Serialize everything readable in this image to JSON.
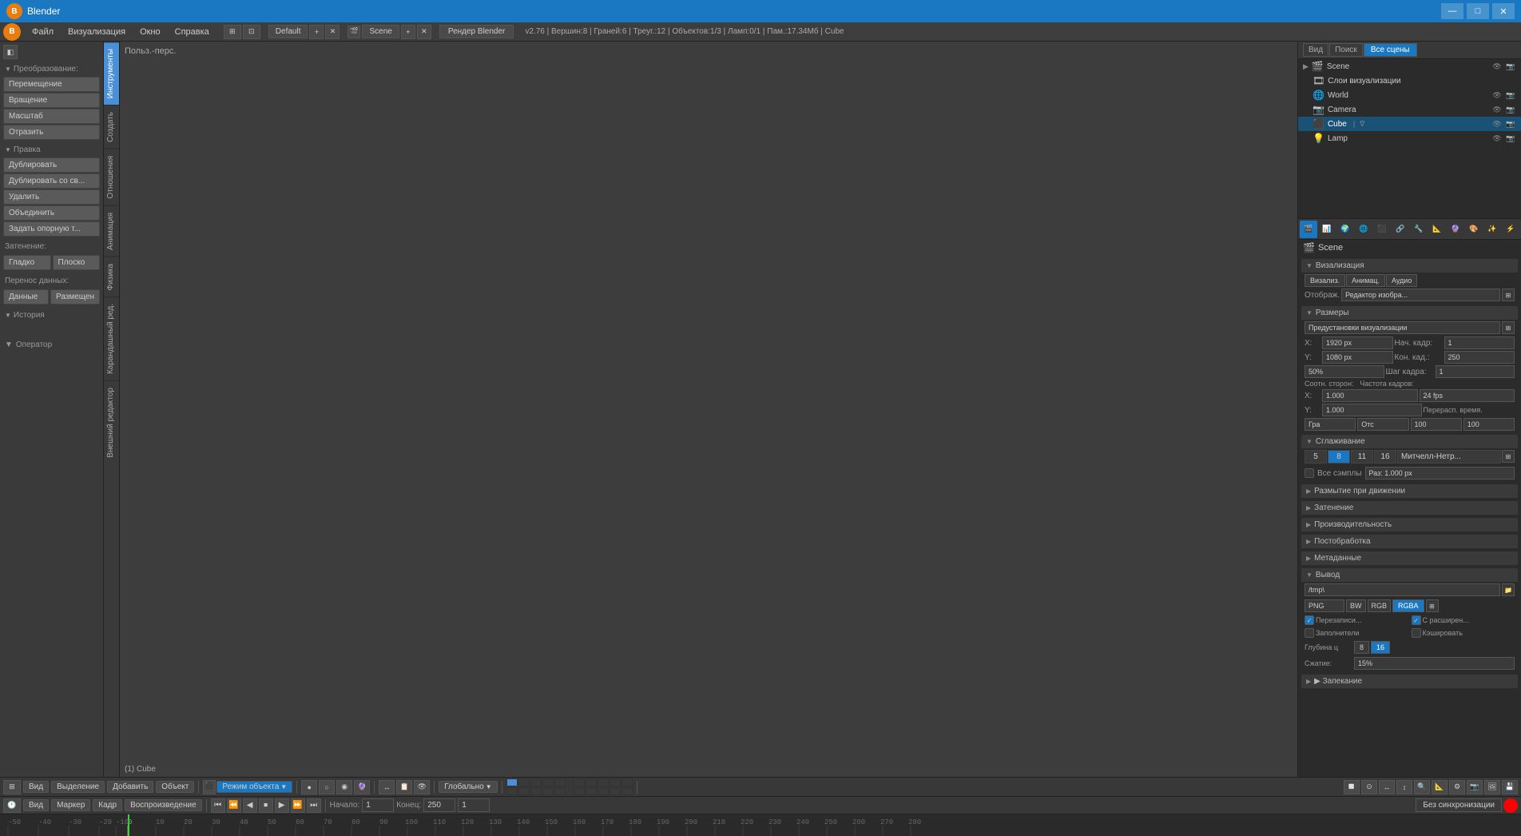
{
  "titlebar": {
    "logo": "B",
    "title": "Blender",
    "minimize": "—",
    "maximize": "□",
    "close": "✕"
  },
  "menubar": {
    "items": [
      "Файл",
      "Визуализация",
      "Окно",
      "Справка"
    ]
  },
  "header": {
    "engine": "Рендер Blender",
    "scene": "Scene",
    "workspace": "Default",
    "info": "v2.76 | Вершин:8 | Граней:6 | Треуг.:12 | Объектов:1/3 | Ламп:0/1 | Пам.:17.34Мб | Cube"
  },
  "viewport": {
    "mode_label": "Польз.-перс.",
    "object_label": "(1) Cube"
  },
  "left_panel": {
    "transform_title": "Преобразование:",
    "buttons": {
      "move": "Перемещение",
      "rotate": "Вращение",
      "scale": "Масштаб",
      "mirror": "Отразить",
      "edit_title": "Правка",
      "duplicate": "Дублировать",
      "dup_linked": "Дублировать со св...",
      "delete": "Удалить",
      "join": "Объединить",
      "set_origin": "Задать опорную т...",
      "shading_title": "Затенение:",
      "smooth": "Гладко",
      "flat": "Плоско",
      "data_title": "Перенос данных:",
      "data": "Данные",
      "layout": "Размещен",
      "history_title": "История"
    }
  },
  "outliner": {
    "tabs": [
      "Вид",
      "Поиск",
      "Все сцены"
    ],
    "items": [
      {
        "name": "Scene",
        "type": "scene",
        "indent": 0
      },
      {
        "name": "Слои визуализации",
        "type": "layer",
        "indent": 1
      },
      {
        "name": "World",
        "type": "world",
        "indent": 1
      },
      {
        "name": "Camera",
        "type": "camera",
        "indent": 1
      },
      {
        "name": "Cube",
        "type": "mesh",
        "indent": 1,
        "selected": true
      },
      {
        "name": "Lamp",
        "type": "lamp",
        "indent": 1
      }
    ]
  },
  "properties": {
    "scene_name": "Scene",
    "tabs": [
      "render",
      "render_layers",
      "scene",
      "world",
      "object",
      "constraints",
      "modifiers",
      "data",
      "material",
      "texture",
      "particles",
      "physics"
    ],
    "active_tab": "render",
    "visualize": {
      "title": "Визализация",
      "tabs": [
        "Визализ.",
        "Анимац.",
        "Аудио"
      ],
      "display_label": "Отображ.",
      "display_value": "Редактор изобра..."
    },
    "resolution": {
      "title": "Размеры",
      "preset_label": "Предустановки визуализации",
      "x_label": "X:",
      "x_value": "1920 px",
      "y_label": "Y:",
      "y_value": "1080 px",
      "percent": "50%",
      "start_frame_label": "Нач. кадр:",
      "start_frame": "1",
      "end_frame_label": "Кон. кад.:",
      "end_frame": "250",
      "frame_step_label": "Шаг кадра:",
      "frame_step": "1",
      "aspect_x_label": "X:",
      "aspect_x": "1.000",
      "aspect_y_label": "Y:",
      "aspect_y": "1.000",
      "frame_rate": "24 fps",
      "speed_label": "Перерасп. время.",
      "aspect_label": "Соотн. сторон:",
      "fps_label": "Частота кадров:",
      "fps_buttons": [
        "Гра",
        "Отс",
        "100",
        "100"
      ]
    },
    "antialiasing": {
      "title": "Сглаживание",
      "values": [
        "5",
        "8",
        "11",
        "16"
      ],
      "active": "8",
      "filter_label": "Митчелл-Нетр...",
      "all_samples": "Все сэмплы",
      "sample_size": "Раз: 1.000 px"
    },
    "motion_blur": {
      "title": "Размытие при движении"
    },
    "shading": {
      "title": "Затенение"
    },
    "performance": {
      "title": "Производительность"
    },
    "post_processing": {
      "title": "Постобработка"
    },
    "metadata": {
      "title": "Метаданные"
    },
    "output": {
      "title": "Вывод",
      "path": "/tmp\\",
      "format": "PNG",
      "bw_btn": "BW",
      "rgb_btn": "RGB",
      "rgba_btn": "RGBA",
      "overwrite_label": "Перезаписи...",
      "placeholders_label": "Заполнители",
      "cache_label": "Кэшировать",
      "with_ext_label": "С расширен...",
      "color_depth_label": "Глубина ц",
      "color_depth_values": [
        "8",
        "16"
      ],
      "compression_label": "Сжатие:",
      "compression_value": "15%"
    }
  },
  "bottom_bar": {
    "tabs_left": [
      "Вид",
      "Выделение",
      "Добавить",
      "Объект"
    ],
    "mode_btn": "Режим объекта",
    "pivot": "Глобально",
    "object_label": "(1) Cube"
  },
  "timeline": {
    "tabs_left": [
      "Вид",
      "Маркер",
      "Кадр",
      "Воспроизведение"
    ],
    "start_label": "Начало:",
    "start_value": "1",
    "end_label": "Конец:",
    "end_value": "250",
    "current_frame": "1",
    "sync_mode": "Без синхронизации",
    "ruler_marks": [
      "-50",
      "-40",
      "-30",
      "-20",
      "-10",
      "0",
      "10",
      "20",
      "30",
      "40",
      "50",
      "60",
      "70",
      "80",
      "90",
      "100",
      "110",
      "120",
      "130",
      "140",
      "150",
      "160",
      "170",
      "180",
      "190",
      "200",
      "210",
      "220",
      "230",
      "240",
      "250",
      "260",
      "270",
      "280"
    ]
  }
}
